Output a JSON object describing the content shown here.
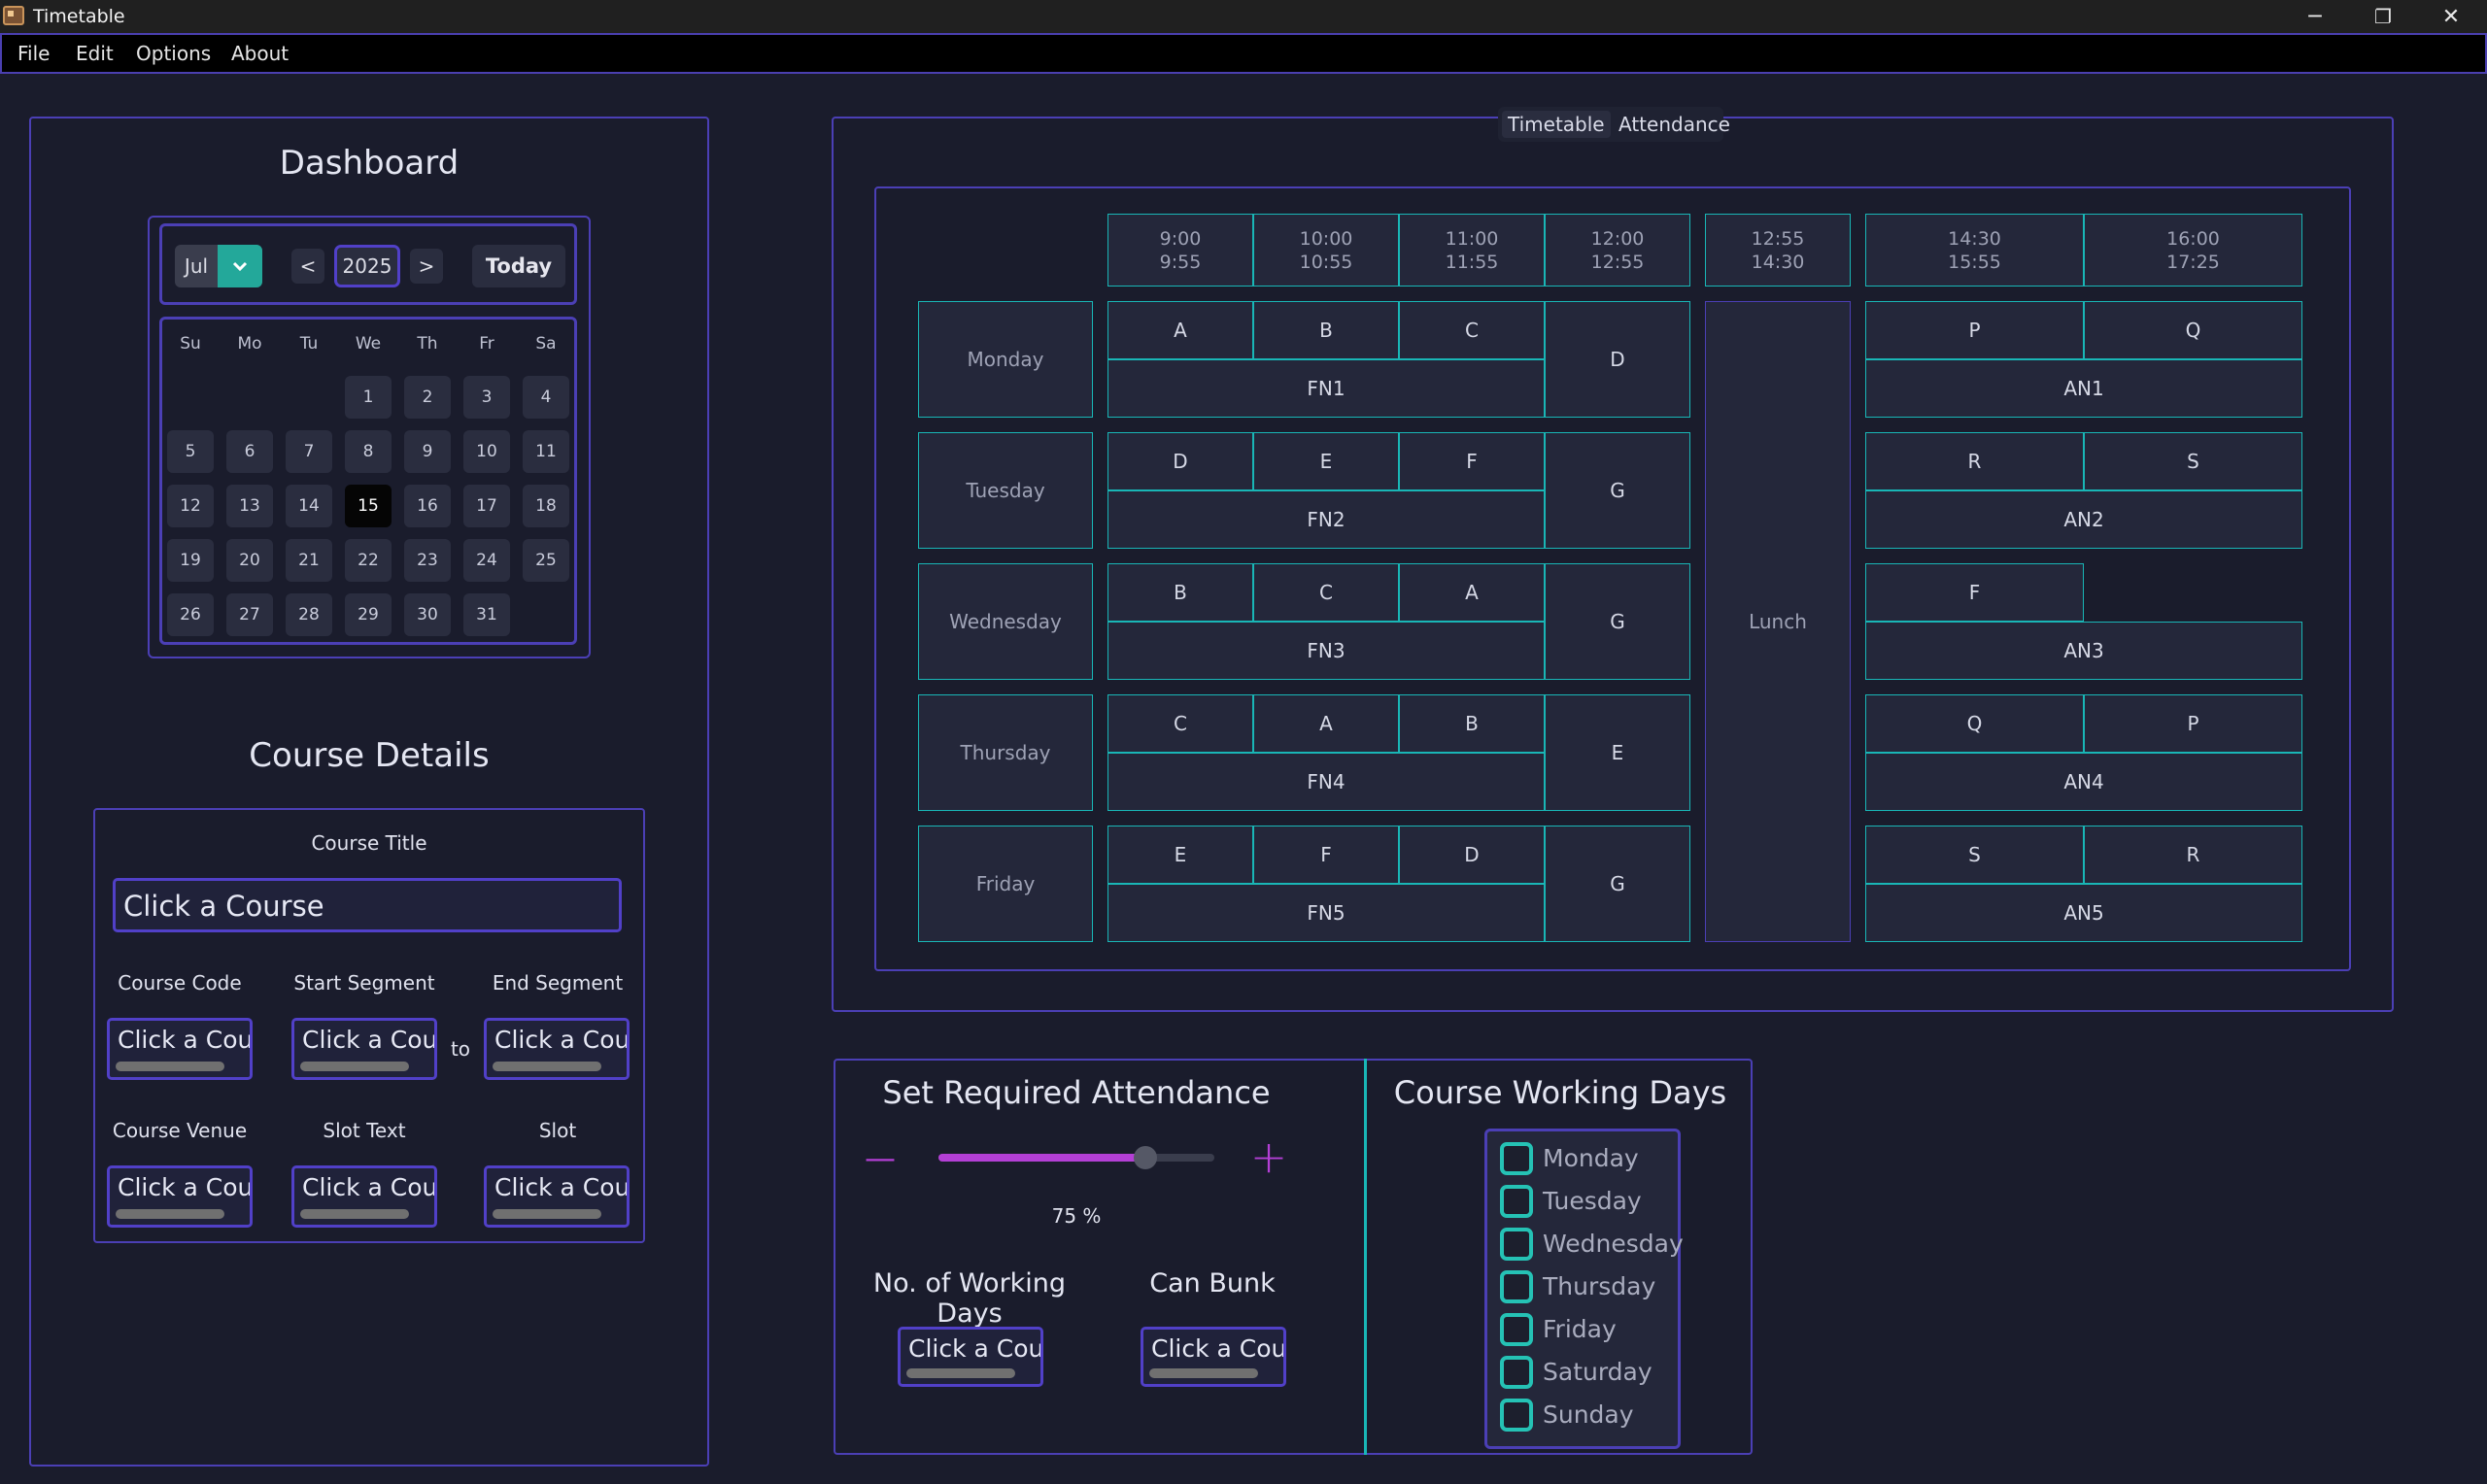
{
  "window": {
    "title": "Timetable",
    "minimize": "─",
    "maximize": "❐",
    "close": "✕"
  },
  "menu": [
    "File",
    "Edit",
    "Options",
    "About"
  ],
  "dashboard": {
    "title": "Dashboard",
    "month": "Jul",
    "year": "2025",
    "prev": "<",
    "next": ">",
    "today": "Today",
    "weekdays": [
      "Su",
      "Mo",
      "Tu",
      "We",
      "Th",
      "Fr",
      "Sa"
    ],
    "days": [
      "1",
      "2",
      "3",
      "4",
      "5",
      "6",
      "7",
      "8",
      "9",
      "10",
      "11",
      "12",
      "13",
      "14",
      "15",
      "16",
      "17",
      "18",
      "19",
      "20",
      "21",
      "22",
      "23",
      "24",
      "25",
      "26",
      "27",
      "28",
      "29",
      "30",
      "31"
    ],
    "selected_day": "15"
  },
  "course_details": {
    "title": "Course Details",
    "course_title_label": "Course Title",
    "course_title_value": "Click a Course",
    "code_label": "Course Code",
    "start_label": "Start Segment",
    "end_label": "End Segment",
    "to_label": "to",
    "venue_label": "Course Venue",
    "slot_text_label": "Slot Text",
    "slot_label": "Slot",
    "field_value": "Click a Cour"
  },
  "tabs": {
    "timetable": "Timetable",
    "attendance": "Attendance"
  },
  "timetable": {
    "times": [
      [
        "9:00",
        "9:55"
      ],
      [
        "10:00",
        "10:55"
      ],
      [
        "11:00",
        "11:55"
      ],
      [
        "12:00",
        "12:55"
      ],
      [
        "12:55",
        "14:30"
      ],
      [
        "14:30",
        "15:55"
      ],
      [
        "16:00",
        "17:25"
      ]
    ],
    "days": [
      "Monday",
      "Tuesday",
      "Wednesday",
      "Thursday",
      "Friday"
    ],
    "lunch": "Lunch",
    "rows": [
      {
        "fn_slots": [
          "A",
          "B",
          "C"
        ],
        "fn": "FN1",
        "noon": "D",
        "an_slots": [
          "P",
          "Q"
        ],
        "an": "AN1"
      },
      {
        "fn_slots": [
          "D",
          "E",
          "F"
        ],
        "fn": "FN2",
        "noon": "G",
        "an_slots": [
          "R",
          "S"
        ],
        "an": "AN2"
      },
      {
        "fn_slots": [
          "B",
          "C",
          "A"
        ],
        "fn": "FN3",
        "noon": "G",
        "an_slots": [
          "F"
        ],
        "an": "AN3"
      },
      {
        "fn_slots": [
          "C",
          "A",
          "B"
        ],
        "fn": "FN4",
        "noon": "E",
        "an_slots": [
          "Q",
          "P"
        ],
        "an": "AN4"
      },
      {
        "fn_slots": [
          "E",
          "F",
          "D"
        ],
        "fn": "FN5",
        "noon": "G",
        "an_slots": [
          "S",
          "R"
        ],
        "an": "AN5"
      }
    ]
  },
  "attendance": {
    "title": "Set Required Attendance",
    "minus": "—",
    "plus": "+",
    "percent": 75,
    "percent_text": "75 %",
    "working_days_label": "No. of Working Days",
    "can_bunk_label": "Can Bunk",
    "field_value": "Click a Cour"
  },
  "working_days": {
    "title": "Course Working Days",
    "days": [
      "Monday",
      "Tuesday",
      "Wednesday",
      "Thursday",
      "Friday",
      "Saturday",
      "Sunday"
    ]
  },
  "colors": {
    "background": "#1a1c2c",
    "panel_border": "#4b3fb5",
    "timetable_border": "#19b6b6",
    "accent_teal": "#23a89a",
    "slider_fill": "#b43fd6"
  }
}
